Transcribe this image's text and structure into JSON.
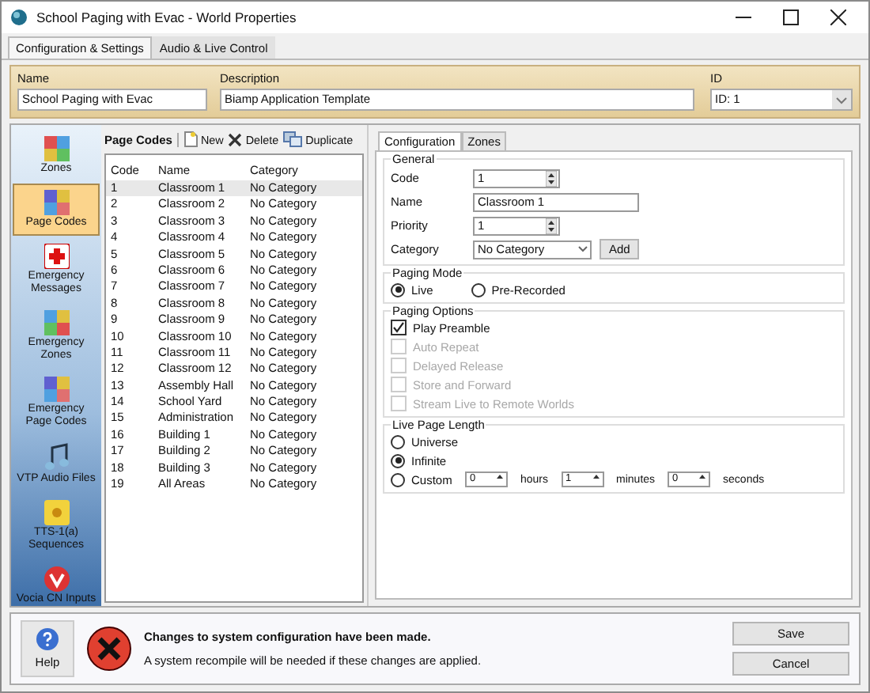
{
  "window": {
    "title": "School Paging with Evac - World Properties"
  },
  "tabs": [
    {
      "label": "Configuration & Settings",
      "selected": true
    },
    {
      "label": "Audio & Live Control",
      "selected": false
    }
  ],
  "header": {
    "name_label": "Name",
    "name_value": "School Paging with Evac",
    "description_label": "Description",
    "description_value": "Biamp Application Template",
    "id_label": "ID",
    "id_value": "ID: 1"
  },
  "nav": [
    {
      "label": "Zones",
      "kind": "grid",
      "selected": false
    },
    {
      "label": "Page Codes",
      "kind": "codes",
      "selected": true
    },
    {
      "label": "Emergency Messages",
      "kind": "cross",
      "selected": false
    },
    {
      "label": "Emergency Zones",
      "kind": "crossgrid",
      "selected": false
    },
    {
      "label": "Emergency Page Codes",
      "kind": "codes",
      "selected": false
    },
    {
      "label": "VTP Audio Files",
      "kind": "music",
      "selected": false
    },
    {
      "label": "TTS-1(a) Sequences",
      "kind": "badge",
      "selected": false
    },
    {
      "label": "Vocia CN Inputs",
      "kind": "mic",
      "selected": false
    }
  ],
  "page_codes": {
    "title": "Page Codes",
    "actions": [
      {
        "label": "New",
        "kind": "new"
      },
      {
        "label": "Delete",
        "kind": "delete"
      },
      {
        "label": "Duplicate",
        "kind": "duplicate"
      }
    ],
    "columns": [
      "Code",
      "Name",
      "Category"
    ],
    "rows": [
      {
        "code": "1",
        "name": "Classroom 1",
        "category": "No Category",
        "selected": true
      },
      {
        "code": "2",
        "name": "Classroom 2",
        "category": "No Category",
        "selected": false
      },
      {
        "code": "3",
        "name": "Classroom 3",
        "category": "No Category",
        "selected": false
      },
      {
        "code": "4",
        "name": "Classroom 4",
        "category": "No Category",
        "selected": false
      },
      {
        "code": "5",
        "name": "Classroom 5",
        "category": "No Category",
        "selected": false
      },
      {
        "code": "6",
        "name": "Classroom 6",
        "category": "No Category",
        "selected": false
      },
      {
        "code": "7",
        "name": "Classroom 7",
        "category": "No Category",
        "selected": false
      },
      {
        "code": "8",
        "name": "Classroom 8",
        "category": "No Category",
        "selected": false
      },
      {
        "code": "9",
        "name": "Classroom 9",
        "category": "No Category",
        "selected": false
      },
      {
        "code": "10",
        "name": "Classroom 10",
        "category": "No Category",
        "selected": false
      },
      {
        "code": "11",
        "name": "Classroom 11",
        "category": "No Category",
        "selected": false
      },
      {
        "code": "12",
        "name": "Classroom 12",
        "category": "No Category",
        "selected": false
      },
      {
        "code": "13",
        "name": "Assembly Hall",
        "category": "No Category",
        "selected": false
      },
      {
        "code": "14",
        "name": "School Yard",
        "category": "No Category",
        "selected": false
      },
      {
        "code": "15",
        "name": "Administration",
        "category": "No Category",
        "selected": false
      },
      {
        "code": "16",
        "name": "Building 1",
        "category": "No Category",
        "selected": false
      },
      {
        "code": "17",
        "name": "Building 2",
        "category": "No Category",
        "selected": false
      },
      {
        "code": "18",
        "name": "Building 3",
        "category": "No Category",
        "selected": false
      },
      {
        "code": "19",
        "name": "All Areas",
        "category": "No Category",
        "selected": false
      }
    ]
  },
  "detail": {
    "tabs": [
      {
        "label": "Configuration",
        "selected": true
      },
      {
        "label": "Zones",
        "selected": false
      }
    ],
    "general": {
      "title": "General",
      "fields": [
        {
          "label": "Code",
          "value": "1",
          "kind": "spin"
        },
        {
          "label": "Name",
          "value": "Classroom 1",
          "kind": "text"
        },
        {
          "label": "Priority",
          "value": "1",
          "kind": "spin"
        },
        {
          "label": "Category",
          "value": "No Category",
          "kind": "select"
        }
      ],
      "add_button": "Add"
    },
    "paging_mode": {
      "title": "Paging Mode",
      "options": [
        {
          "label": "Live",
          "selected": true
        },
        {
          "label": "Pre-Recorded",
          "selected": false
        }
      ]
    },
    "paging_options": {
      "title": "Paging Options",
      "options": [
        {
          "label": "Play Preamble",
          "checked": true,
          "disabled": false
        },
        {
          "label": "Auto Repeat",
          "checked": false,
          "disabled": true
        },
        {
          "label": "Delayed Release",
          "checked": false,
          "disabled": true
        },
        {
          "label": "Store and Forward",
          "checked": false,
          "disabled": true
        },
        {
          "label": "Stream Live to Remote Worlds",
          "checked": false,
          "disabled": true
        }
      ]
    },
    "live_page_length": {
      "title": "Live Page Length",
      "options": [
        {
          "label": "Universe",
          "selected": false
        },
        {
          "label": "Infinite",
          "selected": true
        },
        {
          "label": "Custom",
          "selected": false,
          "parts": [
            {
              "value": "0",
              "unit": "hours"
            },
            {
              "value": "1",
              "unit": "minutes"
            },
            {
              "value": "0",
              "unit": "seconds"
            }
          ]
        }
      ]
    }
  },
  "footer": {
    "help": "Help",
    "message_title": "Changes to system configuration have been made.",
    "message_body": "A system recompile will be needed if these changes are applied.",
    "buttons": [
      "Save",
      "Cancel"
    ]
  }
}
